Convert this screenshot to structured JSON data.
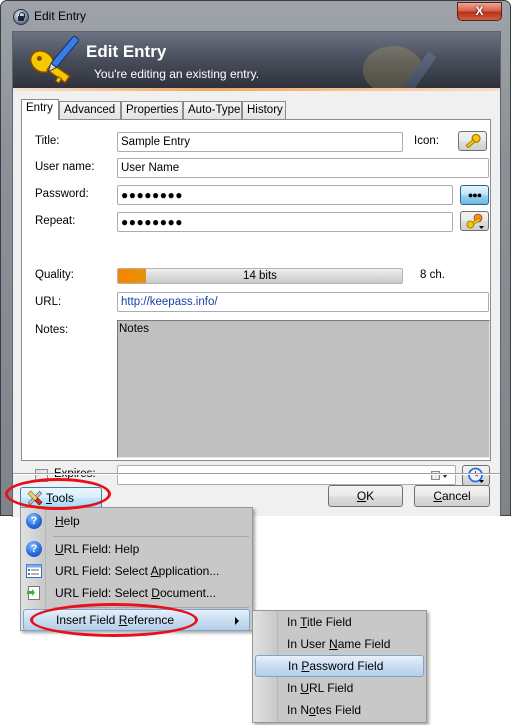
{
  "window": {
    "title": "Edit Entry",
    "close_label": "X"
  },
  "banner": {
    "title": "Edit Entry",
    "subtitle": "You're editing an existing entry."
  },
  "tabs": [
    {
      "label": "Entry",
      "active": true
    },
    {
      "label": "Advanced",
      "active": false
    },
    {
      "label": "Properties",
      "active": false
    },
    {
      "label": "Auto-Type",
      "active": false
    },
    {
      "label": "History",
      "active": false
    }
  ],
  "entry": {
    "title_label": "Title:",
    "title_value": "Sample Entry",
    "icon_label": "Icon:",
    "username_label": "User name:",
    "username_value": "User Name",
    "password_label": "Password:",
    "password_value": "●●●●●●●●",
    "show_password_label": "●●●",
    "repeat_label": "Repeat:",
    "repeat_value": "●●●●●●●●",
    "quality_label": "Quality:",
    "quality_text": "14 bits",
    "quality_fraction": 0.1,
    "char_count": "8 ch.",
    "url_label": "URL:",
    "url_value": "http://keepass.info/",
    "notes_label": "Notes:",
    "notes_value": "Notes",
    "expires_label": "Expires:",
    "expires_checked": false,
    "expires_value": ""
  },
  "buttons": {
    "tools": {
      "label_u": "T",
      "label_rest": "ools"
    },
    "ok": {
      "label_u": "O",
      "label_rest": "K"
    },
    "cancel": {
      "label_u": "C",
      "label_rest": "ancel"
    }
  },
  "tools_menu": {
    "items": [
      {
        "pre": "",
        "u": "H",
        "post": "elp",
        "icon": "help-icon"
      },
      {
        "pre": "",
        "u": "U",
        "post": "RL Field: Help",
        "icon": "help-icon"
      },
      {
        "pre": "URL Field: Select ",
        "u": "A",
        "post": "pplication...",
        "icon": "application-list-icon"
      },
      {
        "pre": "URL Field: Select ",
        "u": "D",
        "post": "ocument...",
        "icon": "document-icon"
      },
      {
        "pre": "Insert Field ",
        "u": "R",
        "post": "eference",
        "icon": "",
        "submenu": true,
        "highlighted": true
      }
    ]
  },
  "field_ref_submenu": {
    "items": [
      {
        "pre": "In ",
        "u": "T",
        "post": "itle Field",
        "highlighted": false
      },
      {
        "pre": "In User ",
        "u": "N",
        "post": "ame Field",
        "highlighted": false
      },
      {
        "pre": "In ",
        "u": "P",
        "post": "assword Field",
        "highlighted": true
      },
      {
        "pre": "In ",
        "u": "U",
        "post": "RL Field",
        "highlighted": false
      },
      {
        "pre": "In N",
        "u": "o",
        "post": "tes Field",
        "highlighted": false
      }
    ]
  },
  "colors": {
    "annotation": "#e8101a",
    "quality_fill": "#f18a00",
    "url_text": "#1a3ea8",
    "notes_bg": "#c0c0c0"
  }
}
